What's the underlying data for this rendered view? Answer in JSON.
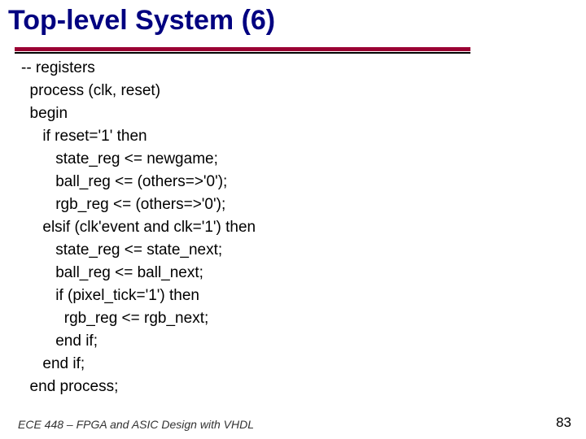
{
  "title": "Top-level System (6)",
  "code": "-- registers\n  process (clk, reset)\n  begin\n     if reset='1' then\n        state_reg <= newgame;\n        ball_reg <= (others=>'0');\n        rgb_reg <= (others=>'0');\n     elsif (clk'event and clk='1') then\n        state_reg <= state_next;\n        ball_reg <= ball_next;\n        if (pixel_tick='1') then\n          rgb_reg <= rgb_next;\n        end if;\n     end if;\n  end process;",
  "footer_left": "ECE 448 – FPGA and ASIC Design with VHDL",
  "page_number": "83"
}
